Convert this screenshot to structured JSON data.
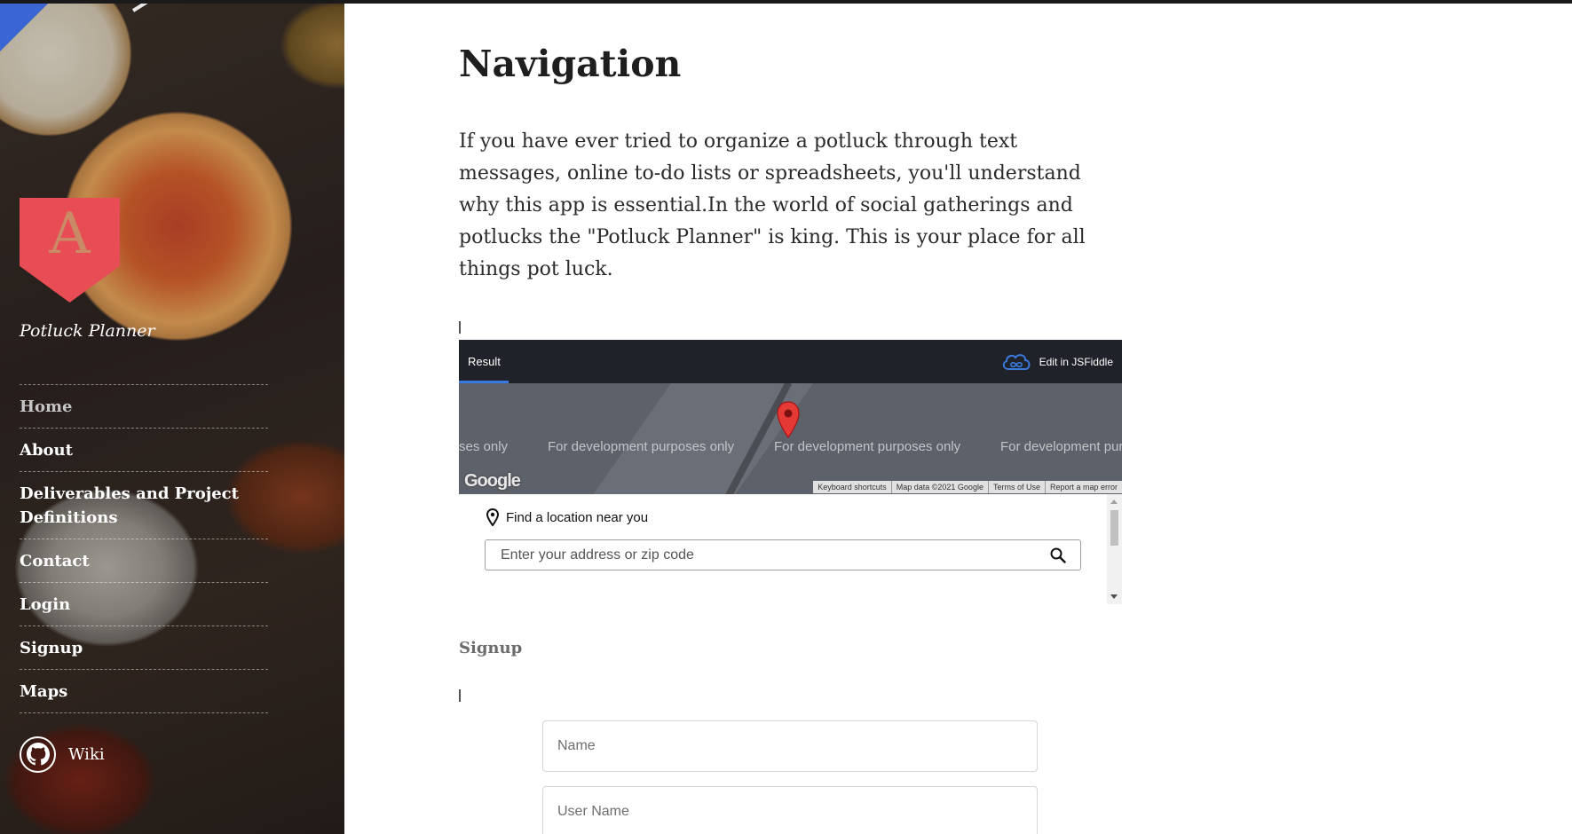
{
  "sidebar": {
    "site_title": "Potluck Planner",
    "logo_letter": "A",
    "nav": [
      {
        "label": "Home",
        "active": true
      },
      {
        "label": "About",
        "active": false
      },
      {
        "label": "Deliverables and Project Definitions",
        "active": false
      },
      {
        "label": "Contact",
        "active": false
      },
      {
        "label": "Login",
        "active": false
      },
      {
        "label": "Signup",
        "active": false
      },
      {
        "label": "Maps",
        "active": false
      }
    ],
    "wiki_label": "Wiki",
    "wiki_icon": "github-icon"
  },
  "main": {
    "title": "Navigation",
    "intro": "If you have ever tried to organize a potluck through text messages, online to-do lists or spreadsheets, you'll understand why this app is essential.In the world of social gatherings and potlucks the \"Potluck Planner\" is king. This is your place for all things pot luck.",
    "fiddle": {
      "tab_label": "Result",
      "edit_label": "Edit in JSFiddle",
      "map": {
        "dev_texts": [
          "ses only",
          "For development purposes only",
          "For development purposes only",
          "For development pur"
        ],
        "google_label": "Google",
        "footer_links": [
          "Keyboard shortcuts",
          "Map data ©2021 Google",
          "Terms of Use",
          "Report a map error"
        ]
      },
      "finder": {
        "heading": "Find a location near you",
        "placeholder": "Enter your address or zip code"
      }
    },
    "signup": {
      "title": "Signup",
      "name_placeholder": "Name",
      "username_placeholder": "User Name"
    }
  },
  "colors": {
    "logo": "#e84c55",
    "fiddle_bar": "#1f2228",
    "map_bg": "#5d6169",
    "tab_accent": "#3a7ae0",
    "pin": "#e53935"
  }
}
